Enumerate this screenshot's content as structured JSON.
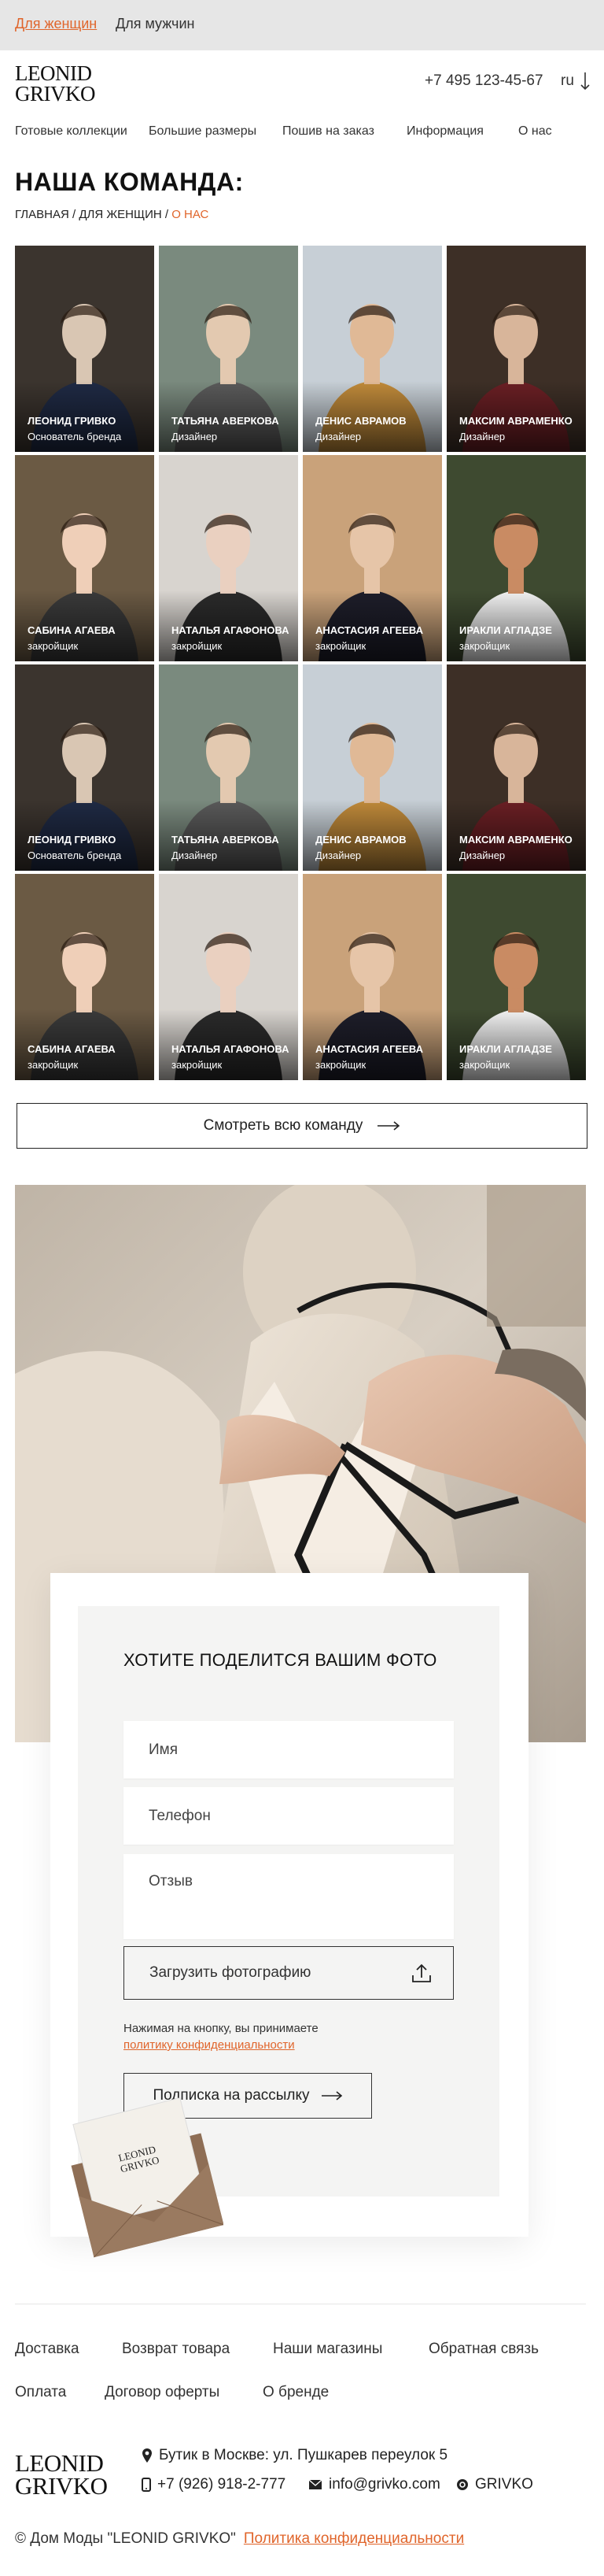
{
  "topbar": {
    "women": "Для женщин",
    "men": "Для мужчин"
  },
  "brand": {
    "line1": "LEONID",
    "line2": "GRIVKO"
  },
  "header": {
    "phone": "+7 495 123-45-67",
    "lang": "ru"
  },
  "nav": [
    "Готовые коллекции",
    "Большие размеры",
    "Пошив на заказ",
    "Информация",
    "О нас"
  ],
  "page": {
    "title": "НАША КОМАНДА:",
    "crumb_home": "ГЛАВНАЯ",
    "crumb_sep": " / ",
    "crumb_section": "ДЛЯ ЖЕНЩИН",
    "crumb_current": "О НАС"
  },
  "team": [
    {
      "name": "ЛЕОНИД ГРИВКО",
      "role": "Основатель бренда"
    },
    {
      "name": "ТАТЬЯНА АВЕРКОВА",
      "role": "Дизайнер"
    },
    {
      "name": "ДЕНИС АВРАМОВ",
      "role": "Дизайнер"
    },
    {
      "name": "МАКСИМ АВРАМЕНКО",
      "role": "Дизайнер"
    },
    {
      "name": "САБИНА АГАЕВА",
      "role": "закройщик"
    },
    {
      "name": "НАТАЛЬЯ АГАФОНОВА",
      "role": "закройщик"
    },
    {
      "name": "АНАСТАСИЯ АГЕЕВА",
      "role": "закройщик"
    },
    {
      "name": "ИРАКЛИ АГЛАДЗЕ",
      "role": "закройщик"
    },
    {
      "name": "ЛЕОНИД ГРИВКО",
      "role": "Основатель бренда"
    },
    {
      "name": "ТАТЬЯНА АВЕРКОВА",
      "role": "Дизайнер"
    },
    {
      "name": "ДЕНИС АВРАМОВ",
      "role": "Дизайнер"
    },
    {
      "name": "МАКСИМ АВРАМЕНКО",
      "role": "Дизайнер"
    },
    {
      "name": "САБИНА АГАЕВА",
      "role": "закройщик"
    },
    {
      "name": "НАТАЛЬЯ АГАФОНОВА",
      "role": "закройщик"
    },
    {
      "name": "АНАСТАСИЯ АГЕЕВА",
      "role": "закройщик"
    },
    {
      "name": "ИРАКЛИ АГЛАДЗЕ",
      "role": "закройщик"
    }
  ],
  "team_button": "Смотреть всю команду",
  "form": {
    "title": "ХОТИТЕ ПОДЕЛИТСЯ ВАШИМ ФОТО",
    "name_placeholder": "Имя",
    "phone_placeholder": "Телефон",
    "review_placeholder": "Отзыв",
    "upload_label": "Загрузить фотографию",
    "note": "Нажимая на кнопку, вы принимаете",
    "policy_link": "политику конфиденциальности",
    "subscribe": "Подписка на рассылку"
  },
  "footer": {
    "links_row1": [
      "Доставка",
      "Возврат товара",
      "Наши магазины",
      "Обратная связь"
    ],
    "links_row2": [
      "Оплата",
      "Договор оферты",
      "О бренде"
    ],
    "address": "Бутик в Москве: ул. Пушкарев переулок 5",
    "phone": "+7 (926) 918-2-777",
    "email": "info@grivko.com",
    "social": "GRIVKO",
    "copyright": "© Дом Моды \"LEONID GRIVKO\"",
    "policy": "Политика конфиденциальности"
  },
  "colors": {
    "accent": "#e0652b",
    "text": "#222222",
    "topbar": "#e6e6e6",
    "form_bg": "#f4f4f3"
  }
}
